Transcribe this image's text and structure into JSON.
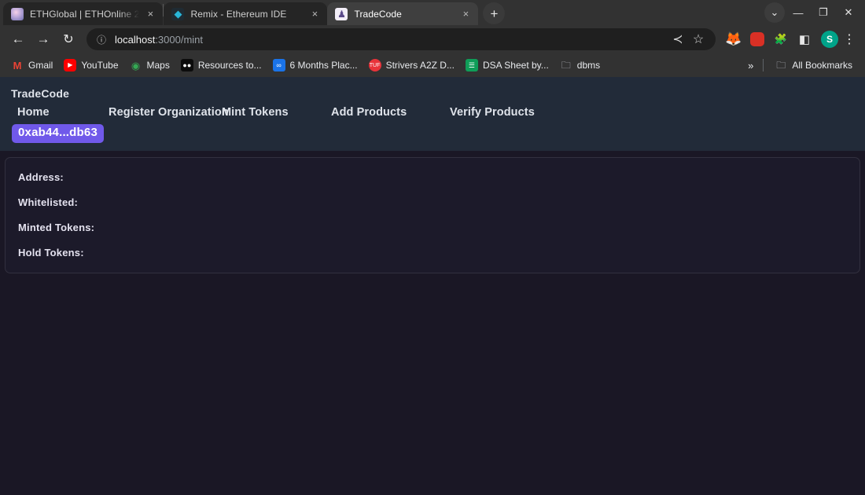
{
  "browser": {
    "tabs": [
      {
        "title": "ETHGlobal | ETHOnline 2",
        "icon": "ethglobal-favicon",
        "icon_glyph": "",
        "active": false
      },
      {
        "title": "Remix - Ethereum IDE",
        "icon": "remix-favicon",
        "icon_glyph": "◆",
        "active": false
      },
      {
        "title": "TradeCode",
        "icon": "tradecode-favicon",
        "icon_glyph": "♟",
        "active": true
      }
    ],
    "tab_close_glyph": "×",
    "new_tab_label": "+",
    "window_controls": {
      "tab_search": "⌄",
      "minimize": "—",
      "maximize": "❐",
      "close": "✕"
    },
    "toolbar": {
      "back": "←",
      "forward": "→",
      "reload": "↻",
      "site_info": "ⓘ",
      "url_host": "localhost",
      "url_path": ":3000/mint",
      "share": "≺",
      "bookmark_star": "☆",
      "extensions": [
        {
          "name": "metamask-extension-icon",
          "glyph": "🦊"
        },
        {
          "name": "red-extension-icon",
          "glyph": "◉"
        },
        {
          "name": "extensions-puzzle-icon",
          "glyph": "🧩"
        },
        {
          "name": "side-panel-icon",
          "glyph": "◧"
        }
      ],
      "profile_initial": "S",
      "menu": "⋮"
    },
    "bookmarks": [
      {
        "label": "Gmail",
        "icon": "gmail-icon",
        "glyph": "M",
        "cls": "ic-gmail"
      },
      {
        "label": "YouTube",
        "icon": "youtube-icon",
        "glyph": "▶",
        "cls": "ic-youtube"
      },
      {
        "label": "Maps",
        "icon": "maps-icon",
        "glyph": "◉",
        "cls": "ic-maps"
      },
      {
        "label": "Resources to...",
        "icon": "resources-icon",
        "glyph": "●●",
        "cls": "ic-doc-dark"
      },
      {
        "label": "6 Months Plac...",
        "icon": "six-months-plan-icon",
        "glyph": "∞",
        "cls": "ic-blue"
      },
      {
        "label": "Strivers A2Z D...",
        "icon": "strivers-icon",
        "glyph": "TUF",
        "cls": "ic-red-circ"
      },
      {
        "label": "DSA Sheet by...",
        "icon": "google-sheets-icon",
        "glyph": "☰",
        "cls": "ic-sheets"
      },
      {
        "label": "dbms",
        "icon": "folder-icon",
        "glyph": "🗀",
        "cls": "ic-folder"
      }
    ],
    "bookmarks_overflow": "»",
    "all_bookmarks": {
      "label": "All Bookmarks",
      "glyph": "🗀"
    }
  },
  "page": {
    "navbar": {
      "brand": "TradeCode",
      "links": [
        {
          "label": "Home",
          "cls": "nl-home"
        },
        {
          "label": "Register Organization",
          "cls": "nl-register"
        },
        {
          "label": "Mint Tokens",
          "cls": "nl-mint"
        },
        {
          "label": "Add Products",
          "cls": "nl-add"
        },
        {
          "label": "Verify Products",
          "cls": "nl-verify"
        }
      ],
      "wallet_address": "0xab44...db63",
      "accent_color": "#7059ea"
    },
    "info_card": {
      "rows": [
        {
          "label": "Address:",
          "value": ""
        },
        {
          "label": "Whitelisted:",
          "value": ""
        },
        {
          "label": "Minted Tokens:",
          "value": ""
        },
        {
          "label": "Hold Tokens:",
          "value": ""
        }
      ]
    }
  }
}
